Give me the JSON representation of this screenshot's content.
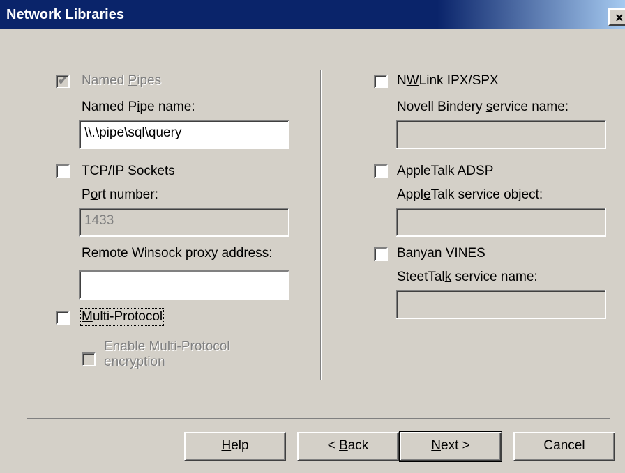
{
  "window": {
    "title": "Network Libraries",
    "close_glyph": "×"
  },
  "left": {
    "named_pipes": {
      "label_pre": "Named ",
      "label_u": "P",
      "label_post": "ipes",
      "checked": true,
      "enabled": false
    },
    "named_pipe_name": {
      "label_pre": "Named P",
      "label_u": "i",
      "label_post": "pe name:",
      "value": "\\\\.\\pipe\\sql\\query"
    },
    "tcpip": {
      "label_pre": "",
      "label_u": "T",
      "label_post": "CP/IP Sockets",
      "checked": false
    },
    "port": {
      "label_pre": "P",
      "label_u": "o",
      "label_post": "rt number:",
      "value": "1433",
      "enabled": false
    },
    "proxy": {
      "label_pre": "",
      "label_u": "R",
      "label_post": "emote Winsock proxy address:",
      "value": ""
    },
    "multiprotocol": {
      "label_pre": "",
      "label_u": "M",
      "label_post": "ulti-Protocol",
      "checked": false
    },
    "encryption": {
      "line1": "Enable Multi-Protocol",
      "line2_pre": "encr",
      "line2_u": "y",
      "line2_post": "ption",
      "checked": false,
      "enabled": false
    }
  },
  "right": {
    "nwlink": {
      "label_pre": "N",
      "label_u": "W",
      "label_post": "Link IPX/SPX",
      "checked": false
    },
    "novell": {
      "label_pre": "Novell Bindery ",
      "label_u": "s",
      "label_post": "ervice name:",
      "value": ""
    },
    "appletalk": {
      "label_pre": "",
      "label_u": "A",
      "label_post": "ppleTalk ADSP",
      "checked": false
    },
    "appletalk_obj": {
      "label_pre": "Appl",
      "label_u": "e",
      "label_post": "Talk service object:",
      "value": ""
    },
    "banyan": {
      "label_pre": "Banyan ",
      "label_u": "V",
      "label_post": "INES",
      "checked": false
    },
    "streettalk": {
      "label_pre": "SteetTal",
      "label_u": "k",
      "label_post": " service name:",
      "value": ""
    }
  },
  "buttons": {
    "help": {
      "pre": "",
      "u": "H",
      "post": "elp"
    },
    "back": {
      "pre": "< ",
      "u": "B",
      "post": "ack"
    },
    "next": {
      "pre": "",
      "u": "N",
      "post": "ext >"
    },
    "cancel": {
      "label": "Cancel"
    }
  },
  "colors": {
    "title_bar": "#0a246a",
    "dialog_bg": "#d4d0c8",
    "disabled_text": "#808080"
  }
}
